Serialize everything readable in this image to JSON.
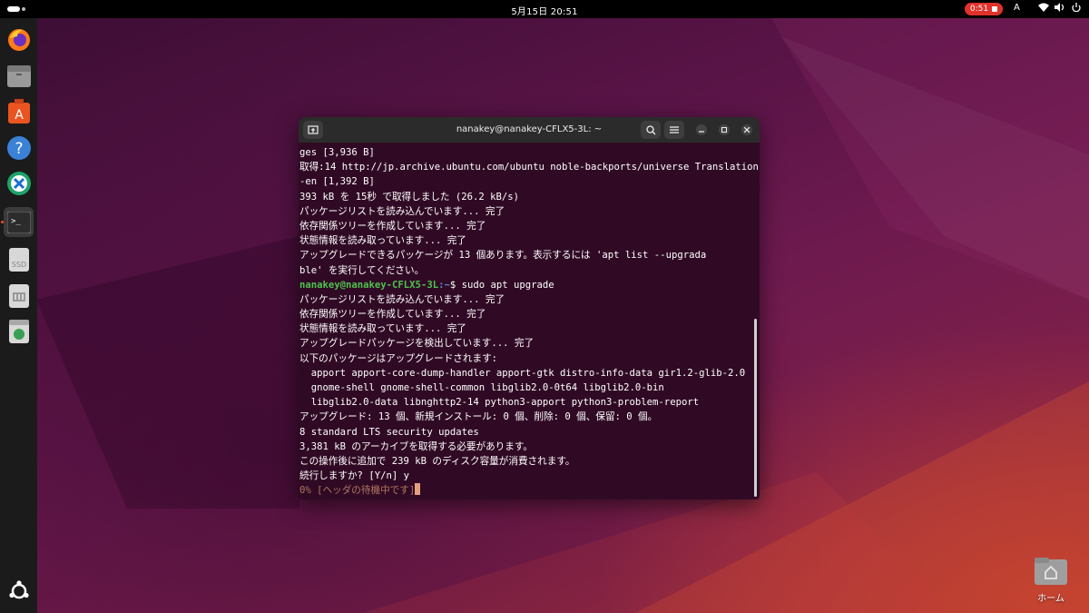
{
  "topbar": {
    "clock": "5月15日  20:51",
    "recording_time": "0:51",
    "input_method": "A"
  },
  "dock": {
    "items": [
      {
        "name": "firefox-icon"
      },
      {
        "name": "files-icon"
      },
      {
        "name": "app-center-icon"
      },
      {
        "name": "help-icon"
      },
      {
        "name": "remote-desktop-icon"
      },
      {
        "name": "terminal-icon"
      },
      {
        "name": "ssd-drive-icon",
        "label": "SSD"
      },
      {
        "name": "sd-card-icon"
      },
      {
        "name": "trash-icon"
      }
    ]
  },
  "desktop": {
    "home_label": "ホーム"
  },
  "terminal": {
    "title": "nanakey@nanakey-CFLX5-3L: ~",
    "prompt_user": "nanakey@nanakey-CFLX5-3L",
    "prompt_path": ":~",
    "lines": [
      {
        "text": "ges [3,936 B]"
      },
      {
        "text": "取得:14 http://jp.archive.ubuntu.com/ubuntu noble-backports/universe Translation"
      },
      {
        "text": "-en [1,392 B]"
      },
      {
        "text": "393 kB を 15秒 で取得しました (26.2 kB/s)"
      },
      {
        "text": "パッケージリストを読み込んでいます... 完了"
      },
      {
        "text": "依存関係ツリーを作成しています... 完了"
      },
      {
        "text": "状態情報を読み取っています... 完了"
      },
      {
        "text": "アップグレードできるパッケージが 13 個あります。表示するには 'apt list --upgrada"
      },
      {
        "text": "ble' を実行してください。"
      },
      {
        "prompt": true,
        "text": "$ sudo apt upgrade"
      },
      {
        "text": "パッケージリストを読み込んでいます... 完了"
      },
      {
        "text": "依存関係ツリーを作成しています... 完了"
      },
      {
        "text": "状態情報を読み取っています... 完了"
      },
      {
        "text": "アップグレードパッケージを検出しています... 完了"
      },
      {
        "text": "以下のパッケージはアップグレードされます:"
      },
      {
        "text": "  apport apport-core-dump-handler apport-gtk distro-info-data gir1.2-glib-2.0"
      },
      {
        "text": "  gnome-shell gnome-shell-common libglib2.0-0t64 libglib2.0-bin"
      },
      {
        "text": "  libglib2.0-data libnghttp2-14 python3-apport python3-problem-report"
      },
      {
        "text": "アップグレード: 13 個、新規インストール: 0 個、削除: 0 個、保留: 0 個。"
      },
      {
        "text": "8 standard LTS security updates"
      },
      {
        "text": "3,381 kB のアーカイブを取得する必要があります。"
      },
      {
        "text": "この操作後に追加で 239 kB のディスク容量が消費されます。"
      },
      {
        "text": "続行しますか? [Y/n] y"
      },
      {
        "dim": true,
        "cursor": true,
        "text": "0% [ヘッダの待機中です]"
      }
    ]
  }
}
